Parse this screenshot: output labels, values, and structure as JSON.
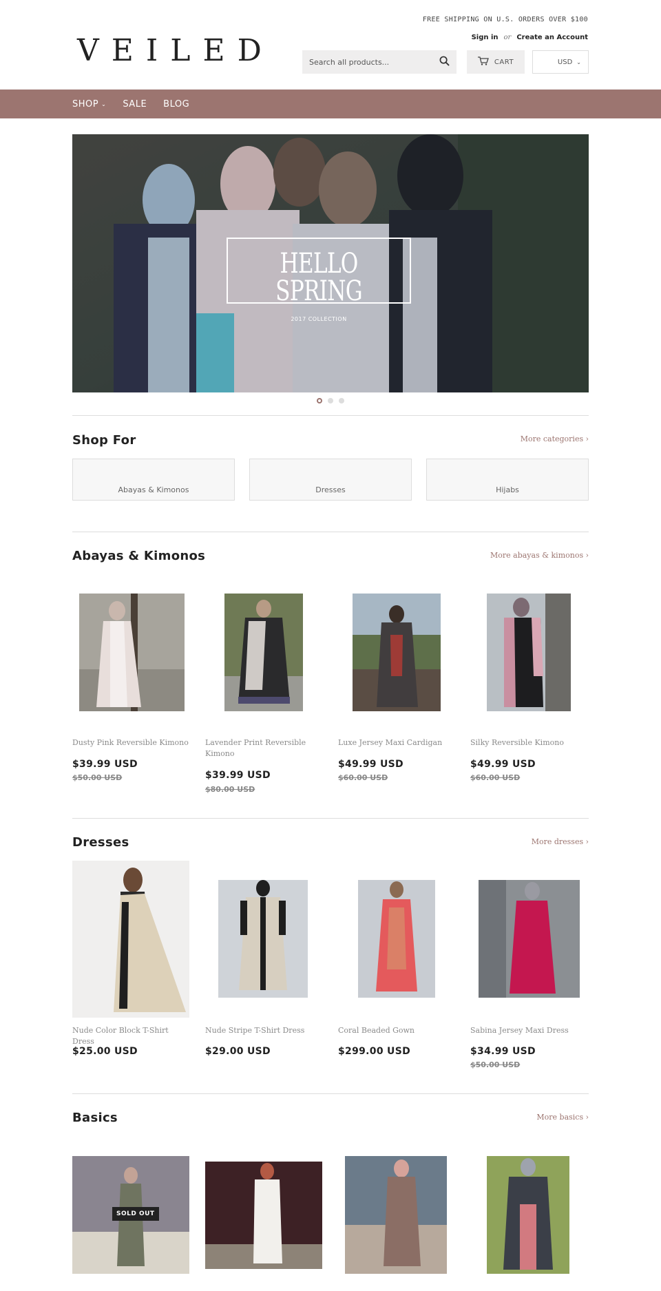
{
  "header": {
    "logo": "VEILED",
    "shipping": "FREE SHIPPING ON U.S. ORDERS OVER $100",
    "sign_in": "Sign in",
    "or": "or",
    "create_account": "Create an Account",
    "search_placeholder": "Search all products...",
    "cart_label": "CART",
    "currency": "USD"
  },
  "nav": {
    "items": [
      {
        "label": "SHOP",
        "has_dropdown": true
      },
      {
        "label": "SALE"
      },
      {
        "label": "BLOG"
      }
    ]
  },
  "hero": {
    "title": "HELLO SPRING",
    "subtitle": "2017 COLLECTION",
    "slide_count": 3,
    "active_slide": 1
  },
  "shop_for": {
    "title": "Shop For",
    "more": "More categories ›",
    "categories": [
      "Abayas & Kimonos",
      "Dresses",
      "Hijabs"
    ]
  },
  "abayas": {
    "title": "Abayas & Kimonos",
    "more": "More abayas & kimonos ›",
    "products": [
      {
        "name": "Dusty Pink Reversible Kimono",
        "price": "$39.99 USD",
        "compare": "$50.00 USD"
      },
      {
        "name": "Lavender Print Reversible Kimono",
        "price": "$39.99 USD",
        "compare": "$80.00 USD"
      },
      {
        "name": "Luxe Jersey Maxi Cardigan",
        "price": "$49.99 USD",
        "compare": "$60.00 USD"
      },
      {
        "name": "Silky Reversible Kimono",
        "price": "$49.99 USD",
        "compare": "$60.00 USD"
      }
    ]
  },
  "dresses": {
    "title": "Dresses",
    "more": "More dresses ›",
    "products": [
      {
        "name": "Nude Color Block T-Shirt Dress",
        "price": "$25.00 USD"
      },
      {
        "name": "Nude Stripe T-Shirt Dress",
        "price": "$29.00 USD"
      },
      {
        "name": "Coral Beaded Gown",
        "price": "$299.00 USD"
      },
      {
        "name": "Sabina Jersey Maxi Dress",
        "price": "$34.99 USD",
        "compare": "$50.00 USD"
      }
    ]
  },
  "basics": {
    "title": "Basics",
    "more": "More basics ›",
    "sold_out": "SOLD OUT"
  },
  "colors": {
    "accent": "#9c7570",
    "text": "#222222",
    "muted": "#8a8a8a",
    "field_bg": "#efeeee"
  }
}
